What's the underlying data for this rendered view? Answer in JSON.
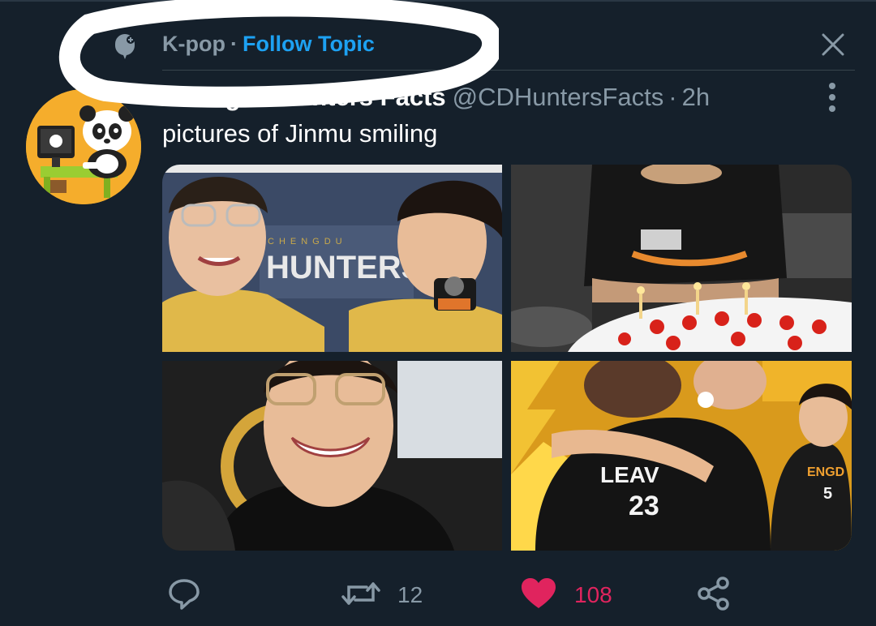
{
  "topic": {
    "name": "K-pop",
    "separator": "·",
    "follow_label": "Follow Topic"
  },
  "tweet": {
    "author_name": "Chengdu Hunters Facts",
    "handle": "@CDHuntersFacts",
    "separator": "·",
    "time": "2h",
    "text": "pictures of Jinmu smiling"
  },
  "media": {
    "photo1_text": "HUNTERS",
    "photo1_small": "CHENGDU",
    "photo4_jersey_name": "LEAV",
    "photo4_jersey_number": "23",
    "photo4_right_name": "ENGD",
    "photo4_right_number": "5"
  },
  "actions": {
    "retweet_count": "12",
    "like_count": "108"
  },
  "colors": {
    "background": "#15202b",
    "accent": "#1da1f2",
    "like": "#e0245e",
    "secondary_text": "#8899a6"
  },
  "icons": {
    "topic": "topic-icon",
    "close": "close-icon",
    "more": "more-vertical-icon",
    "reply": "reply-icon",
    "retweet": "retweet-icon",
    "like": "heart-icon",
    "share": "share-icon"
  }
}
